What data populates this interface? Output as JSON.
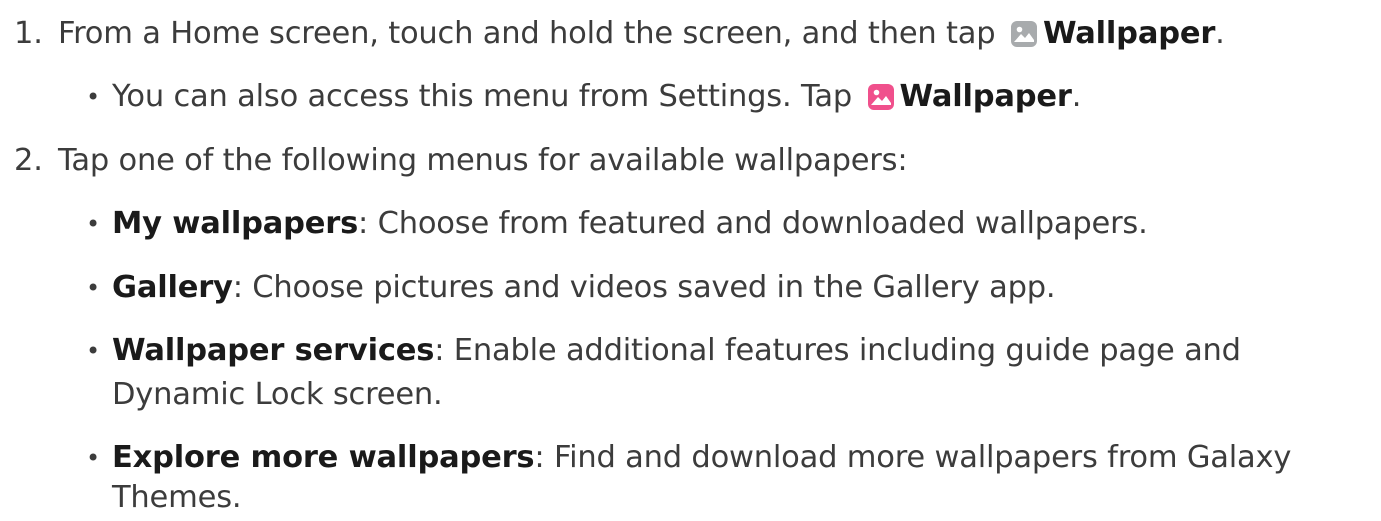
{
  "steps": [
    {
      "number": "1.",
      "text_before": "From a Home screen, touch and hold the screen, and then tap",
      "icon": "wallpaper-icon-gray",
      "bold": "Wallpaper",
      "text_after": ".",
      "substeps": [
        {
          "text_before": "You can also access this menu from Settings. Tap",
          "icon": "wallpaper-icon-pink",
          "bold": "Wallpaper",
          "text_after": "."
        }
      ]
    },
    {
      "number": "2.",
      "text": "Tap one of the following menus for available wallpapers:",
      "substeps": [
        {
          "bold": "My wallpapers",
          "text": ": Choose from featured and downloaded wallpapers."
        },
        {
          "bold": "Gallery",
          "text": ": Choose pictures and videos saved in the Gallery app."
        },
        {
          "bold": "Wallpaper services",
          "text": ": Enable additional features including guide page and",
          "text_line2": "Dynamic Lock screen."
        },
        {
          "bold": "Explore more wallpapers",
          "text": ": Find and download more wallpapers from Galaxy",
          "text_line2": "Themes."
        }
      ]
    }
  ],
  "bullet_char": "•",
  "colors": {
    "text": "#3c3c3c",
    "bold_text": "#1a1a1a",
    "icon_gray": "#a8abad",
    "icon_pink": "#f0508c"
  }
}
